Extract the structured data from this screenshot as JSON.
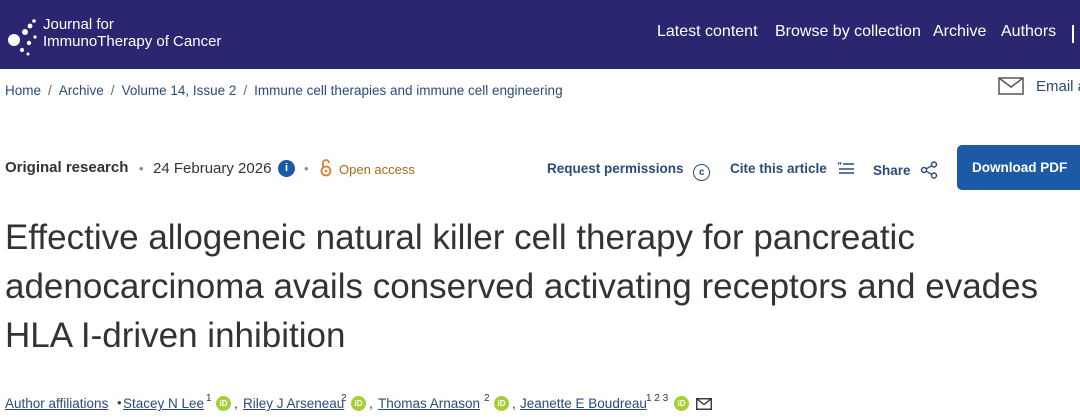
{
  "header": {
    "journal_line1": "Journal for",
    "journal_line2": "ImmunoTherapy of Cancer",
    "nav": [
      "Latest content",
      "Browse by collection",
      "Archive",
      "Authors"
    ],
    "brand_color": "#2b2670"
  },
  "breadcrumb": [
    "Home",
    "Archive",
    "Volume 14, Issue 2",
    "Immune cell therapies and immune cell engineering"
  ],
  "email_alerts": {
    "label": "Email a",
    "icon": "envelope-icon"
  },
  "meta": {
    "article_type": "Original research",
    "date": "24 February 2026",
    "access": "Open access",
    "info_icon": "info-icon",
    "lock_icon": "open-lock-icon"
  },
  "actions": {
    "request_permissions": "Request permissions",
    "cite": "Cite this article",
    "share": "Share",
    "download": "Download PDF"
  },
  "title_lines": [
    "Effective allogeneic natural killer cell therapy for pancreatic",
    "adenocarcinoma avails conserved activating receptors and evades",
    "HLA I-driven inhibition"
  ],
  "authors": {
    "affiliations_label": "Author affiliations",
    "list": [
      {
        "name": "Stacey N Lee",
        "sup": "1"
      },
      {
        "name": "Riley J Arseneau",
        "sup": "2"
      },
      {
        "name": "Thomas Arnason",
        "sup": "2"
      },
      {
        "name": "Jeanette E Boudreau",
        "sup": "1 2 3"
      }
    ]
  }
}
